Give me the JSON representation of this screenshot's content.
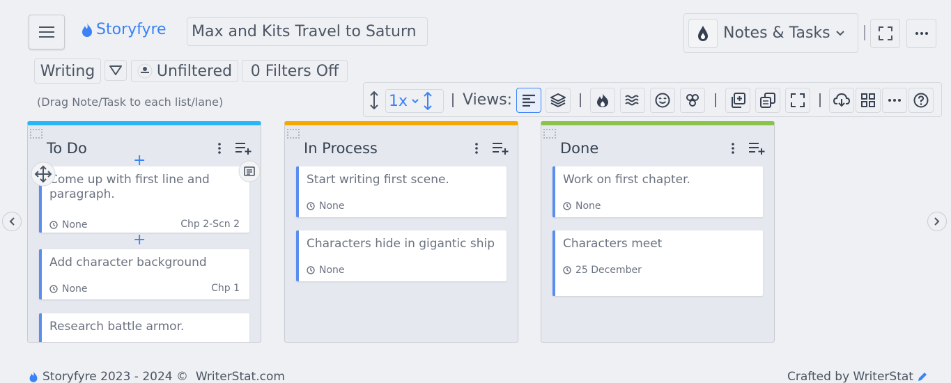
{
  "header": {
    "brand": "Storyfyre",
    "project_title": "Max and Kits Travel to Saturn",
    "view_selector": "Notes & Tasks"
  },
  "filters": {
    "mode": "Writing",
    "unfiltered": "Unfiltered",
    "filters_off": "0 Filters Off",
    "hint": "(Drag Note/Task to each list/lane)"
  },
  "toolbar": {
    "zoom": "1x",
    "views_label": "Views:"
  },
  "lanes": [
    {
      "title": "To Do",
      "accent": "#29b6f6",
      "cards": [
        {
          "text": "Come up with first line and paragraph.",
          "date": "None",
          "chapter": "Chp 2-Scn 2"
        },
        {
          "text": "Add character background",
          "date": "None",
          "chapter": "Chp 1"
        },
        {
          "text": "Research battle armor.",
          "date": "",
          "chapter": ""
        }
      ]
    },
    {
      "title": "In Process",
      "accent": "#f5a900",
      "cards": [
        {
          "text": "Start writing first scene.",
          "date": "None"
        },
        {
          "text": "Characters hide in gigantic ship",
          "date": "None"
        }
      ]
    },
    {
      "title": "Done",
      "accent": "#8bc34a",
      "cards": [
        {
          "text": "Work on first chapter.",
          "date": "None"
        },
        {
          "text": "Characters meet",
          "date": "25 December"
        }
      ]
    }
  ],
  "footer": {
    "left": "Storyfyre 2023 - 2024 ©  WriterStat.com",
    "right": "Crafted by WriterStat"
  },
  "colors": {
    "accent_blue": "#3b82f6",
    "card_border": "#5b8def",
    "background": "#eef0f3"
  }
}
